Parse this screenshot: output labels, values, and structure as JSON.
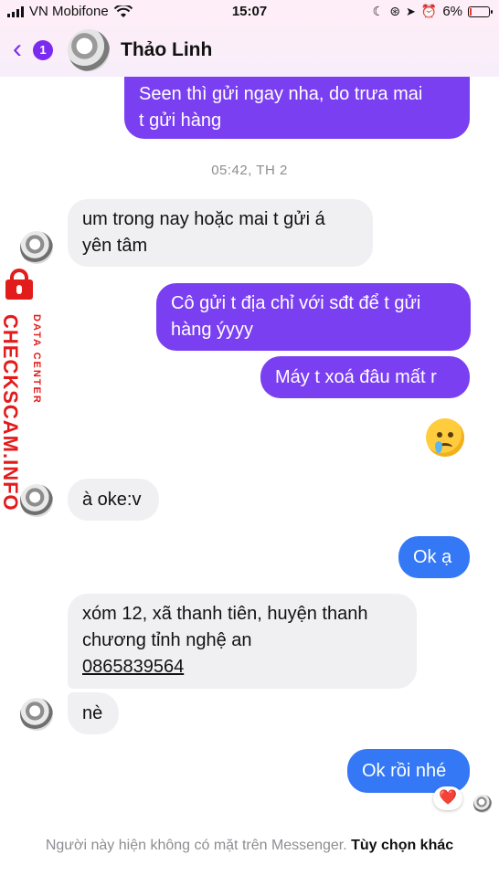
{
  "status_bar": {
    "carrier": "VN Mobifone",
    "time": "15:07",
    "battery": "6%",
    "battery_level": 0.06,
    "icons": [
      "signal-icon",
      "wifi-icon",
      "moon-icon",
      "lock-rotation-icon",
      "location-icon",
      "alarm-icon",
      "battery-icon"
    ]
  },
  "header": {
    "back_badge": "1",
    "contact_name": "Thảo Linh"
  },
  "messages": [
    {
      "side": "out",
      "text": "Seen thì gửi ngay nha, do trưa mai\nt gửi hàng"
    },
    {
      "side": "in",
      "text": "um trong nay hoặc mai t gửi á\nyên tâm"
    },
    {
      "side": "out",
      "text": "Cô gửi t địa chỉ với sđt để t gửi\nhàng ýyyy"
    },
    {
      "side": "out",
      "text": "Máy t xoá đâu mất r"
    },
    {
      "side": "out",
      "emoji": "crying-face"
    },
    {
      "side": "in",
      "text": "à oke:v"
    },
    {
      "side": "out",
      "text": "Ok ạ"
    },
    {
      "side": "in",
      "text_lines": [
        "xóm 12, xã thanh tiên, huyện thanh",
        "chương tỉnh nghệ an"
      ],
      "phone": "0865839564"
    },
    {
      "side": "in",
      "text": "nè"
    },
    {
      "side": "out",
      "text": "Ok rồi nhé",
      "reaction": "❤️"
    }
  ],
  "timestamp": "05:42, TH 2",
  "footer": {
    "notice": "Người này hiện không có mặt trên Messenger.",
    "action": "Tùy chọn khác"
  },
  "watermark": {
    "brand": "CHECKSCAM.INFO",
    "sub": "DATA CENTER"
  },
  "colors": {
    "outgoing_purple": "#7b3ff2",
    "outgoing_blue": "#3478f6",
    "incoming_gray": "#f0f0f2",
    "accent": "#7b2bf0",
    "watermark_red": "#e21b1b"
  }
}
